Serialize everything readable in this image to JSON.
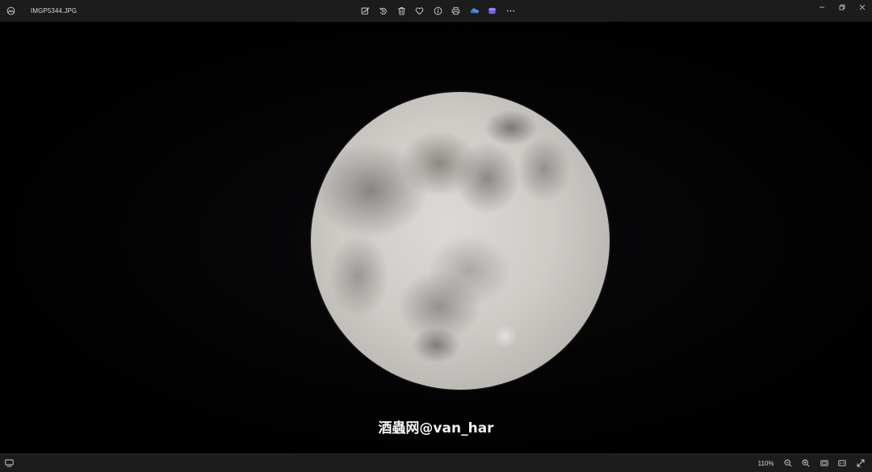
{
  "window": {
    "file_name": "IMGP5344.JPG",
    "app_icon": "photos-app-icon"
  },
  "toolbar": {
    "buttons": [
      "edit-image-icon",
      "rotate-icon",
      "delete-icon",
      "favorite-icon",
      "info-icon",
      "print-icon",
      "onedrive-icon",
      "clipchamp-icon",
      "more-icon"
    ]
  },
  "window_controls": [
    "minimize-icon",
    "restore-icon",
    "close-icon"
  ],
  "viewer": {
    "watermark": "酒蟲网@van_har"
  },
  "statusbar": {
    "zoom_level": "110%",
    "buttons": [
      "filmstrip-icon",
      "zoom-out-icon",
      "zoom-in-icon",
      "fit-to-window-icon",
      "actual-size-icon",
      "full-screen-icon"
    ]
  },
  "colors": {
    "chrome": "#1c1c1c",
    "canvas": "#000000",
    "icon": "#d4d4d4",
    "onedrive": "#4a8fe0",
    "clipchamp": "#7b5cf5"
  }
}
